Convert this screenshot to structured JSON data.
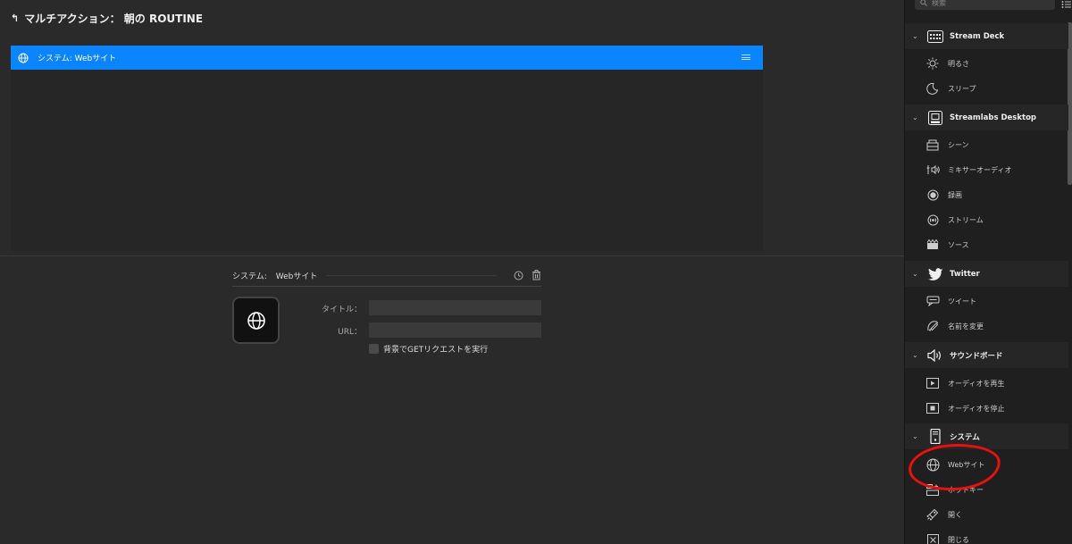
{
  "header": {
    "back_icon": "return-arrow-icon",
    "title": "マルチアクション： 朝の ROUTINE"
  },
  "actions": [
    {
      "label": "システム: Webサイト",
      "icon": "globe-icon"
    }
  ],
  "inspector": {
    "category": "システム:",
    "action": "Webサイト",
    "title_label": "タイトル：",
    "title_value": "",
    "url_label": "URL：",
    "url_value": "",
    "background_get_label": "背景でGETリクエストを実行",
    "background_get_checked": false
  },
  "sidebar": {
    "search_placeholder": "検索",
    "categories": [
      {
        "label": "Stream Deck",
        "icon": "stream-deck-icon",
        "items": [
          {
            "label": "明るさ",
            "icon": "sun-icon"
          },
          {
            "label": "スリープ",
            "icon": "sleep-icon"
          }
        ]
      },
      {
        "label": "Streamlabs Desktop",
        "icon": "streamlabs-icon",
        "items": [
          {
            "label": "シーン",
            "icon": "scene-icon"
          },
          {
            "label": "ミキサーオーディオ",
            "icon": "mixer-audio-icon"
          },
          {
            "label": "録画",
            "icon": "record-icon"
          },
          {
            "label": "ストリーム",
            "icon": "stream-icon"
          },
          {
            "label": "ソース",
            "icon": "source-icon"
          }
        ]
      },
      {
        "label": "Twitter",
        "icon": "twitter-bird-icon",
        "items": [
          {
            "label": "ツイート",
            "icon": "tweet-icon"
          },
          {
            "label": "名前を変更",
            "icon": "rename-icon"
          }
        ]
      },
      {
        "label": "サウンドボード",
        "icon": "speaker-icon",
        "items": [
          {
            "label": "オーディオを再生",
            "icon": "play-audio-icon"
          },
          {
            "label": "オーディオを停止",
            "icon": "stop-audio-icon"
          }
        ]
      },
      {
        "label": "システム",
        "icon": "system-icon",
        "items": [
          {
            "label": "Webサイト",
            "icon": "globe-icon"
          },
          {
            "label": "ホットキー",
            "icon": "hotkey-icon"
          },
          {
            "label": "開く",
            "icon": "open-icon"
          },
          {
            "label": "閉じる",
            "icon": "close-app-icon"
          }
        ]
      }
    ]
  },
  "colors": {
    "accent": "#0a84ff",
    "annotation": "#e81010"
  }
}
